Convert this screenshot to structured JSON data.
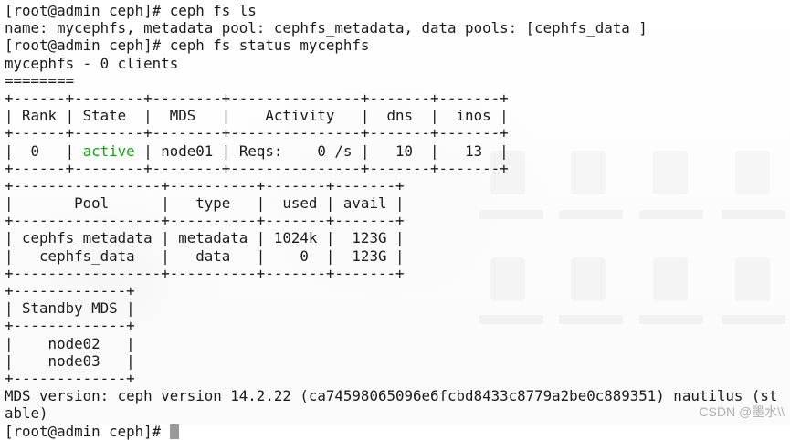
{
  "terminal": {
    "lines": [
      "[root@admin ceph]# ceph fs ls",
      "name: mycephfs, metadata pool: cephfs_metadata, data pools: [cephfs_data ]",
      "[root@admin ceph]# ceph fs status mycephfs",
      "mycephfs - 0 clients",
      "========",
      "+------+--------+--------+---------------+-------+-------+",
      "| Rank | State  |  MDS   |    Activity   |  dns  |  inos |",
      "+------+--------+--------+---------------+-------+-------+"
    ],
    "rank_row": {
      "prefix": "|  0   | ",
      "state": "active",
      "suffix": " | node01 | Reqs:    0 /s |   10  |   13  |"
    },
    "lines_after": [
      "+------+--------+--------+---------------+-------+-------+",
      "+-----------------+----------+-------+-------+",
      "|       Pool      |   type   |  used | avail |",
      "+-----------------+----------+-------+-------+",
      "| cephfs_metadata | metadata | 1024k |  123G |",
      "|   cephfs_data   |   data   |    0  |  123G |",
      "+-----------------+----------+-------+-------+",
      "+-------------+",
      "| Standby MDS |",
      "+-------------+",
      "|    node02   |",
      "|    node03   |",
      "+-------------+",
      "MDS version: ceph version 14.2.22 (ca74598065096e6fcbd8433c8779a2be0c889351) nautilus (st",
      "able)"
    ],
    "prompt_line": "[root@admin ceph]# "
  },
  "watermark": "CSDN @墨水\\\\",
  "colors": {
    "active_state": "#1a9e1a",
    "text": "#1a1a1a",
    "cursor": "#9a9a9a"
  }
}
